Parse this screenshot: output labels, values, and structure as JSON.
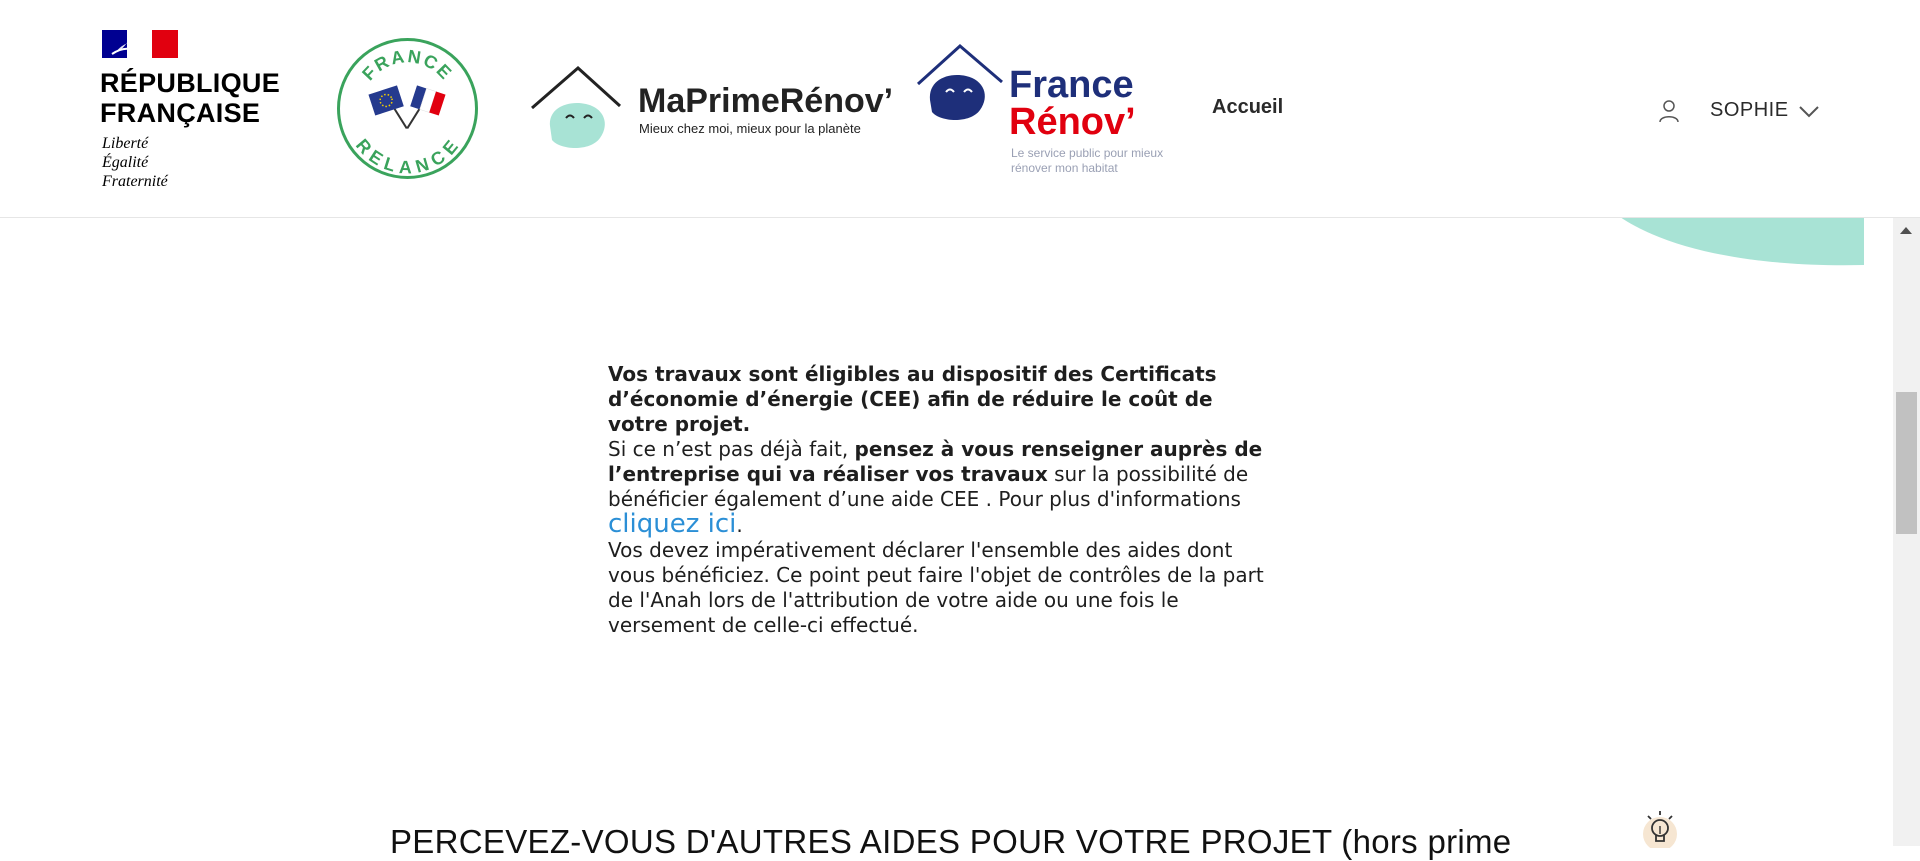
{
  "header": {
    "republique": {
      "title_line1": "RÉPUBLIQUE",
      "title_line2": "FRANÇAISE",
      "motto_line1": "Liberté",
      "motto_line2": "Égalité",
      "motto_line3": "Fraternité"
    },
    "france_relance": {
      "top_text": "FRANCE",
      "bottom_text": "RELANCE"
    },
    "maprimerenov": {
      "name": "MaPrimeRénov’",
      "tagline": "Mieux chez moi, mieux pour la planète"
    },
    "france_renov": {
      "line1": "France",
      "line2": "Rénov’",
      "tagline": "Le service public pour mieux rénover mon habitat"
    },
    "nav": {
      "accueil": "Accueil"
    },
    "user": {
      "name": "SOPHIE"
    }
  },
  "content": {
    "intro_bold": "Vos travaux sont éligibles au dispositif des Certificats d’économie d’énergie (CEE) afin de réduire le coût de votre projet.",
    "p2_start": "Si ce n’est pas déjà fait, ",
    "p2_bold": "pensez à vous renseigner auprès de l’entreprise qui va réaliser vos travaux",
    "p2_mid": " sur la possibilité de bénéficier également d’une aide CEE . Pour plus d'informations ",
    "p2_link": "cliquez ici",
    "p2_end": ".",
    "p3": "Vos devez impérativement déclarer l'ensemble des aides dont vous bénéficiez. Ce point peut faire l'objet de contrôles de la part de l'Anah lors de l'attribution de votre aide ou une fois le versement de celle-ci effectué."
  },
  "section": {
    "title": "PERCEVEZ-VOUS D'AUTRES AIDES POUR VOTRE PROJET (hors prime"
  },
  "colors": {
    "accent_mint": "#a8e3d5",
    "link_blue": "#2b8fd6",
    "france_renov_blue": "#1e2f7a",
    "france_renov_red": "#e1000f",
    "relance_green": "#3aa35c"
  },
  "icons": [
    "user-icon",
    "chevron-down-icon",
    "lightbulb-icon",
    "scroll-up-arrow-icon"
  ]
}
